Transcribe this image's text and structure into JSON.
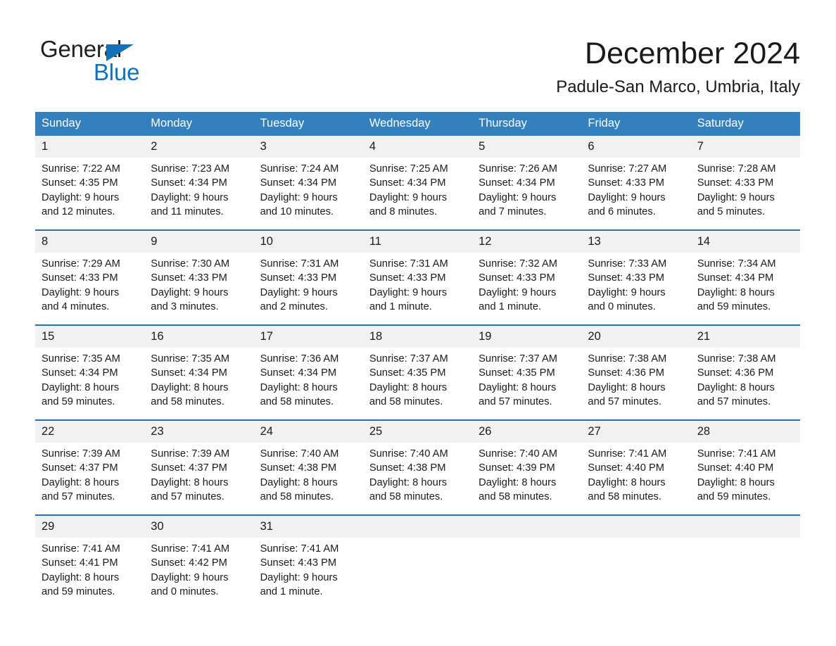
{
  "brand": {
    "name_top": "General",
    "name_bottom": "Blue",
    "triangle_icon": "blue-triangle-icon",
    "accent_color": "#1072b8"
  },
  "header": {
    "title": "December 2024",
    "subtitle": "Padule-San Marco, Umbria, Italy"
  },
  "theme": {
    "header_blue": "#3480bd",
    "row_rule_blue": "#2671b0",
    "daynum_band": "#f1f1f1",
    "text": "#1a1a1a"
  },
  "weekdays": [
    "Sunday",
    "Monday",
    "Tuesday",
    "Wednesday",
    "Thursday",
    "Friday",
    "Saturday"
  ],
  "labels": {
    "sunrise_prefix": "Sunrise:",
    "sunset_prefix": "Sunset:",
    "daylight_prefix": "Daylight:"
  },
  "weeks": [
    [
      {
        "day": "1",
        "sunrise": "Sunrise: 7:22 AM",
        "sunset": "Sunset: 4:35 PM",
        "daylight_line1": "Daylight: 9 hours",
        "daylight_line2": "and 12 minutes."
      },
      {
        "day": "2",
        "sunrise": "Sunrise: 7:23 AM",
        "sunset": "Sunset: 4:34 PM",
        "daylight_line1": "Daylight: 9 hours",
        "daylight_line2": "and 11 minutes."
      },
      {
        "day": "3",
        "sunrise": "Sunrise: 7:24 AM",
        "sunset": "Sunset: 4:34 PM",
        "daylight_line1": "Daylight: 9 hours",
        "daylight_line2": "and 10 minutes."
      },
      {
        "day": "4",
        "sunrise": "Sunrise: 7:25 AM",
        "sunset": "Sunset: 4:34 PM",
        "daylight_line1": "Daylight: 9 hours",
        "daylight_line2": "and 8 minutes."
      },
      {
        "day": "5",
        "sunrise": "Sunrise: 7:26 AM",
        "sunset": "Sunset: 4:34 PM",
        "daylight_line1": "Daylight: 9 hours",
        "daylight_line2": "and 7 minutes."
      },
      {
        "day": "6",
        "sunrise": "Sunrise: 7:27 AM",
        "sunset": "Sunset: 4:33 PM",
        "daylight_line1": "Daylight: 9 hours",
        "daylight_line2": "and 6 minutes."
      },
      {
        "day": "7",
        "sunrise": "Sunrise: 7:28 AM",
        "sunset": "Sunset: 4:33 PM",
        "daylight_line1": "Daylight: 9 hours",
        "daylight_line2": "and 5 minutes."
      }
    ],
    [
      {
        "day": "8",
        "sunrise": "Sunrise: 7:29 AM",
        "sunset": "Sunset: 4:33 PM",
        "daylight_line1": "Daylight: 9 hours",
        "daylight_line2": "and 4 minutes."
      },
      {
        "day": "9",
        "sunrise": "Sunrise: 7:30 AM",
        "sunset": "Sunset: 4:33 PM",
        "daylight_line1": "Daylight: 9 hours",
        "daylight_line2": "and 3 minutes."
      },
      {
        "day": "10",
        "sunrise": "Sunrise: 7:31 AM",
        "sunset": "Sunset: 4:33 PM",
        "daylight_line1": "Daylight: 9 hours",
        "daylight_line2": "and 2 minutes."
      },
      {
        "day": "11",
        "sunrise": "Sunrise: 7:31 AM",
        "sunset": "Sunset: 4:33 PM",
        "daylight_line1": "Daylight: 9 hours",
        "daylight_line2": "and 1 minute."
      },
      {
        "day": "12",
        "sunrise": "Sunrise: 7:32 AM",
        "sunset": "Sunset: 4:33 PM",
        "daylight_line1": "Daylight: 9 hours",
        "daylight_line2": "and 1 minute."
      },
      {
        "day": "13",
        "sunrise": "Sunrise: 7:33 AM",
        "sunset": "Sunset: 4:33 PM",
        "daylight_line1": "Daylight: 9 hours",
        "daylight_line2": "and 0 minutes."
      },
      {
        "day": "14",
        "sunrise": "Sunrise: 7:34 AM",
        "sunset": "Sunset: 4:34 PM",
        "daylight_line1": "Daylight: 8 hours",
        "daylight_line2": "and 59 minutes."
      }
    ],
    [
      {
        "day": "15",
        "sunrise": "Sunrise: 7:35 AM",
        "sunset": "Sunset: 4:34 PM",
        "daylight_line1": "Daylight: 8 hours",
        "daylight_line2": "and 59 minutes."
      },
      {
        "day": "16",
        "sunrise": "Sunrise: 7:35 AM",
        "sunset": "Sunset: 4:34 PM",
        "daylight_line1": "Daylight: 8 hours",
        "daylight_line2": "and 58 minutes."
      },
      {
        "day": "17",
        "sunrise": "Sunrise: 7:36 AM",
        "sunset": "Sunset: 4:34 PM",
        "daylight_line1": "Daylight: 8 hours",
        "daylight_line2": "and 58 minutes."
      },
      {
        "day": "18",
        "sunrise": "Sunrise: 7:37 AM",
        "sunset": "Sunset: 4:35 PM",
        "daylight_line1": "Daylight: 8 hours",
        "daylight_line2": "and 58 minutes."
      },
      {
        "day": "19",
        "sunrise": "Sunrise: 7:37 AM",
        "sunset": "Sunset: 4:35 PM",
        "daylight_line1": "Daylight: 8 hours",
        "daylight_line2": "and 57 minutes."
      },
      {
        "day": "20",
        "sunrise": "Sunrise: 7:38 AM",
        "sunset": "Sunset: 4:36 PM",
        "daylight_line1": "Daylight: 8 hours",
        "daylight_line2": "and 57 minutes."
      },
      {
        "day": "21",
        "sunrise": "Sunrise: 7:38 AM",
        "sunset": "Sunset: 4:36 PM",
        "daylight_line1": "Daylight: 8 hours",
        "daylight_line2": "and 57 minutes."
      }
    ],
    [
      {
        "day": "22",
        "sunrise": "Sunrise: 7:39 AM",
        "sunset": "Sunset: 4:37 PM",
        "daylight_line1": "Daylight: 8 hours",
        "daylight_line2": "and 57 minutes."
      },
      {
        "day": "23",
        "sunrise": "Sunrise: 7:39 AM",
        "sunset": "Sunset: 4:37 PM",
        "daylight_line1": "Daylight: 8 hours",
        "daylight_line2": "and 57 minutes."
      },
      {
        "day": "24",
        "sunrise": "Sunrise: 7:40 AM",
        "sunset": "Sunset: 4:38 PM",
        "daylight_line1": "Daylight: 8 hours",
        "daylight_line2": "and 58 minutes."
      },
      {
        "day": "25",
        "sunrise": "Sunrise: 7:40 AM",
        "sunset": "Sunset: 4:38 PM",
        "daylight_line1": "Daylight: 8 hours",
        "daylight_line2": "and 58 minutes."
      },
      {
        "day": "26",
        "sunrise": "Sunrise: 7:40 AM",
        "sunset": "Sunset: 4:39 PM",
        "daylight_line1": "Daylight: 8 hours",
        "daylight_line2": "and 58 minutes."
      },
      {
        "day": "27",
        "sunrise": "Sunrise: 7:41 AM",
        "sunset": "Sunset: 4:40 PM",
        "daylight_line1": "Daylight: 8 hours",
        "daylight_line2": "and 58 minutes."
      },
      {
        "day": "28",
        "sunrise": "Sunrise: 7:41 AM",
        "sunset": "Sunset: 4:40 PM",
        "daylight_line1": "Daylight: 8 hours",
        "daylight_line2": "and 59 minutes."
      }
    ],
    [
      {
        "day": "29",
        "sunrise": "Sunrise: 7:41 AM",
        "sunset": "Sunset: 4:41 PM",
        "daylight_line1": "Daylight: 8 hours",
        "daylight_line2": "and 59 minutes."
      },
      {
        "day": "30",
        "sunrise": "Sunrise: 7:41 AM",
        "sunset": "Sunset: 4:42 PM",
        "daylight_line1": "Daylight: 9 hours",
        "daylight_line2": "and 0 minutes."
      },
      {
        "day": "31",
        "sunrise": "Sunrise: 7:41 AM",
        "sunset": "Sunset: 4:43 PM",
        "daylight_line1": "Daylight: 9 hours",
        "daylight_line2": "and 1 minute."
      },
      {
        "day": "",
        "sunrise": "",
        "sunset": "",
        "daylight_line1": "",
        "daylight_line2": "",
        "empty": true
      },
      {
        "day": "",
        "sunrise": "",
        "sunset": "",
        "daylight_line1": "",
        "daylight_line2": "",
        "empty": true
      },
      {
        "day": "",
        "sunrise": "",
        "sunset": "",
        "daylight_line1": "",
        "daylight_line2": "",
        "empty": true
      },
      {
        "day": "",
        "sunrise": "",
        "sunset": "",
        "daylight_line1": "",
        "daylight_line2": "",
        "empty": true
      }
    ]
  ]
}
